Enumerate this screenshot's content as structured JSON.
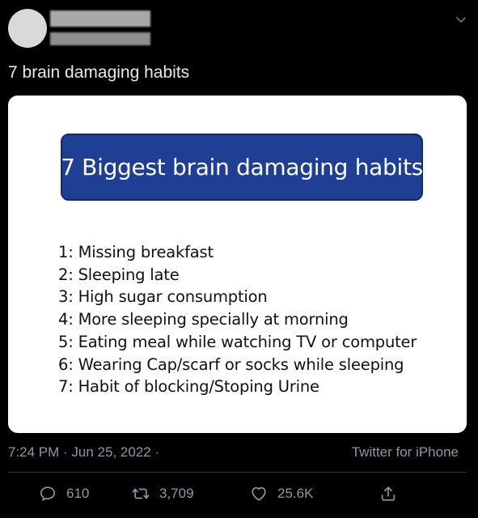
{
  "tweet": {
    "text": "7 brain damaging habits",
    "timestamp": "7:24 PM · Jun 25, 2022 ·",
    "source": "Twitter for iPhone"
  },
  "image": {
    "title": "7 Biggest brain damaging habits",
    "habits": [
      "1: Missing breakfast",
      "2: Sleeping late",
      "3: High sugar consumption",
      "4: More sleeping specially at morning",
      "5: Eating meal while watching TV or computer",
      "6: Wearing Cap/scarf or socks while sleeping",
      "7: Habit of blocking/Stoping Urine"
    ]
  },
  "actions": {
    "replies": "610",
    "retweets": "3,709",
    "likes": "25.6K"
  },
  "icons": {
    "menu": "chevron-down-icon",
    "reply": "reply-icon",
    "retweet": "retweet-icon",
    "like": "heart-icon",
    "share": "share-icon"
  },
  "colors": {
    "background": "#000000",
    "text": "#e7e9ea",
    "muted": "#8b98a5",
    "banner": "#1f3f94"
  }
}
